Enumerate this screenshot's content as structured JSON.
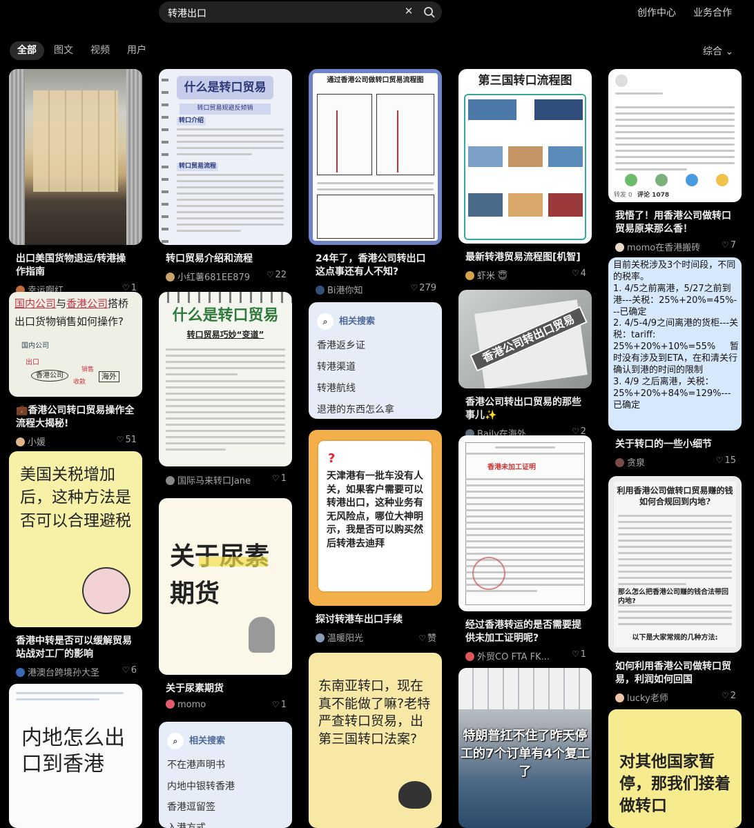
{
  "search": {
    "query": "转港出口"
  },
  "topnav": {
    "creator": "创作中心",
    "business": "业务合作"
  },
  "tabs": [
    "全部",
    "图文",
    "视频",
    "用户"
  ],
  "sort": {
    "label": "综合"
  },
  "cards": [
    {
      "title": "出口美国货物退运/转港操作指南",
      "author": "幸运啊红",
      "likes": "1"
    },
    {
      "title": "转口贸易介绍和流程",
      "author": "小红薯681EE879",
      "likes": "22",
      "img_title": "什么是转口贸易",
      "img_sub": "转口贸易规避反倾销",
      "img_h1": "转口介绍",
      "img_h2": "转口贸易流程"
    },
    {
      "title": "24年了，香港公司转出口这点事还有人不知?",
      "author": "Bi港你知",
      "likes": "279",
      "img_title": "通过香港公司做转口贸易流程图"
    },
    {
      "title": "最新转港贸易流程图[机智]",
      "author": "虾米",
      "author_emoji": "😇",
      "likes": "4",
      "img_title": "第三国转口流程图"
    },
    {
      "title": "我悟了！用香港公司做转口贸易原来那么香！",
      "author": "momo在香港搬砖",
      "likes": "7",
      "img_comment": "评论 1078",
      "img_repost": "转发 0"
    },
    {
      "title": "香港公司转口贸易操作全流程大揭秘!",
      "title_emoji": "💼",
      "author": "小媛",
      "likes": "51",
      "img_line1_a": "国内公司",
      "img_line1_b": "与",
      "img_line1_c": "香港公司",
      "img_line1_d": "搭桥",
      "img_line2": "出口货物销售如何操作?",
      "img_node1": "国内公司",
      "img_node2": "出口",
      "img_node3": "香港公司",
      "img_node4": "销售",
      "img_node5": "收款",
      "img_node6": "海外"
    },
    {
      "title": "",
      "author": "国际马来转口Jane",
      "likes": "1",
      "img_title": "什么是转口贸易",
      "img_sub": "转口贸易巧妙“变道”"
    },
    {
      "title": "",
      "author": "",
      "likes": "",
      "img_text": "天津港有一批车没有人关，如果客户需要可以转港出口，这种业务有无风险点，哪位大神明示，我是否可以购买然后转港去迪拜"
    },
    {
      "title": "香港公司转出口贸易的那些事儿",
      "title_emoji": "✨",
      "author": "Baily在海外",
      "likes": "2",
      "img_text": "香港公司转出口贸易"
    },
    {
      "title": "关于转口的一些小细节",
      "author": "贪泉",
      "likes": "15",
      "img_text": "目前关税涉及3个时间段，不同的税率。\n1. 4/5之前离港，5/27之前到港---关税：25%+20%=45%---已确定\n2. 4/5-4/9之间离港的货柜---关税：tariff: 25%+20%+10%=55%     暂时没有涉及到ETA，在和清关行确认到港的时间的限制\n3. 4/9 之后离港，关税：25%+20%+84%=129%---已确定"
    },
    {
      "title": "香港中转是否可以缓解贸易站战对工厂的影响",
      "author": "港澳台跨境孙大圣",
      "likes": "6",
      "img_text": "美国关税增加后，这种方法是否可以合理避税"
    },
    {
      "title": "关于尿素期货",
      "author": "momo",
      "likes": "1",
      "img_text": "关于尿素期货"
    },
    {
      "title": "探讨转港车出口手续",
      "author": "温暖阳光",
      "likes": "赞"
    },
    {
      "title": "经过香港转运的是否需要提供未加工证明呢?",
      "author": "外贸CO FTA FK...",
      "likes": "1",
      "img_stamp": "香港未加工证明"
    },
    {
      "title": "如何利用香港公司做转口贸易，利润如何回国",
      "author": "lucky老师",
      "likes": "2",
      "img_title": "利用香港公司做转口贸易赚的钱如何合规回到内地?",
      "img_sub": "那么怎么把香港公司赚的钱合法带回内地?",
      "img_foot": "以下是大家常规的几种方法:"
    },
    {
      "title": "",
      "author": "",
      "likes": "",
      "img_text": "内地怎么出口到香港"
    },
    {
      "title": "",
      "author": "",
      "likes": "",
      "img_text": "东南亚转口，现在真不能做了嘛?老特严查转口贸易，出第三国转口法案?"
    },
    {
      "title": "",
      "author": "",
      "likes": "",
      "img_text": "特朗普扛不住了昨天停工的7个订单有4个复工了"
    },
    {
      "title": "",
      "author": "",
      "likes": "",
      "img_text": "对其他国家暂停，那我们接着做转口"
    }
  ],
  "related_1": {
    "header": "相关搜索",
    "items": [
      "香港返乡证",
      "转港渠道",
      "转港航线",
      "退港的东西怎么拿"
    ]
  },
  "related_2": {
    "header": "相关搜索",
    "items": [
      "不在港声明书",
      "内地中银转香港",
      "香港逗留签",
      "入港方式"
    ]
  }
}
